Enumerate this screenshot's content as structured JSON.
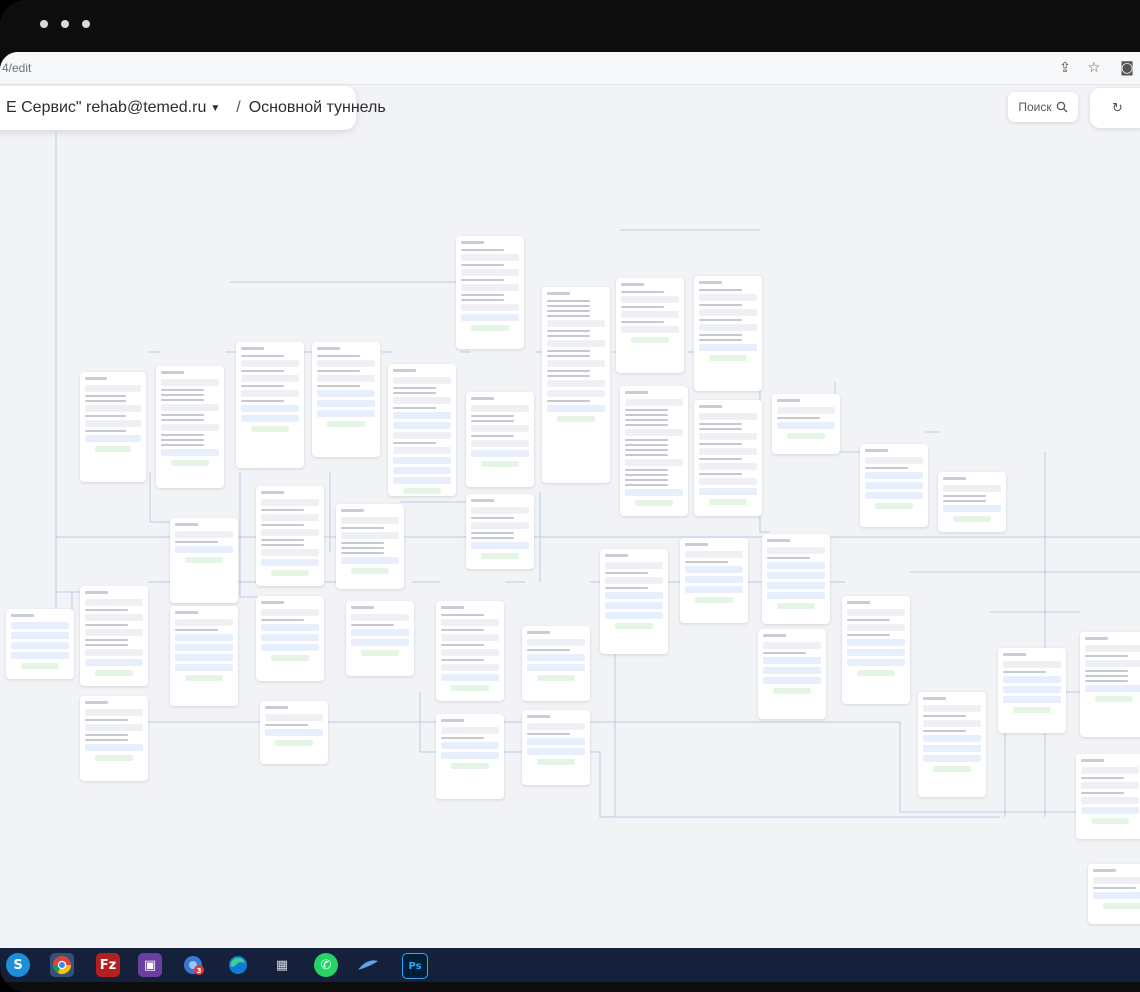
{
  "browser": {
    "url": "4/edit",
    "actions": [
      "share-icon",
      "star-icon",
      "camera-icon"
    ]
  },
  "breadcrumb": {
    "account": "Е Сервис\" rehab@temed.ru",
    "separator": "/",
    "tunnel": "Основной туннель"
  },
  "toolbar": {
    "search_label": "Поиск"
  },
  "taskbar": {
    "apps": [
      "skype-icon",
      "chrome-icon",
      "filezilla-icon",
      "app-icon",
      "chrome-profile-icon",
      "edge-icon",
      "calculator-icon",
      "whatsapp-icon",
      "app-shark-icon",
      "photoshop-icon"
    ],
    "labels": {
      "skype": "S",
      "filezilla": "Fz",
      "photoshop": "Ps"
    },
    "badge": "3"
  },
  "colors": {
    "bezel": "#0d0d0e",
    "canvas": "#f2f3f6",
    "wire": "#b9cbe6",
    "taskbar": "#15213a"
  }
}
